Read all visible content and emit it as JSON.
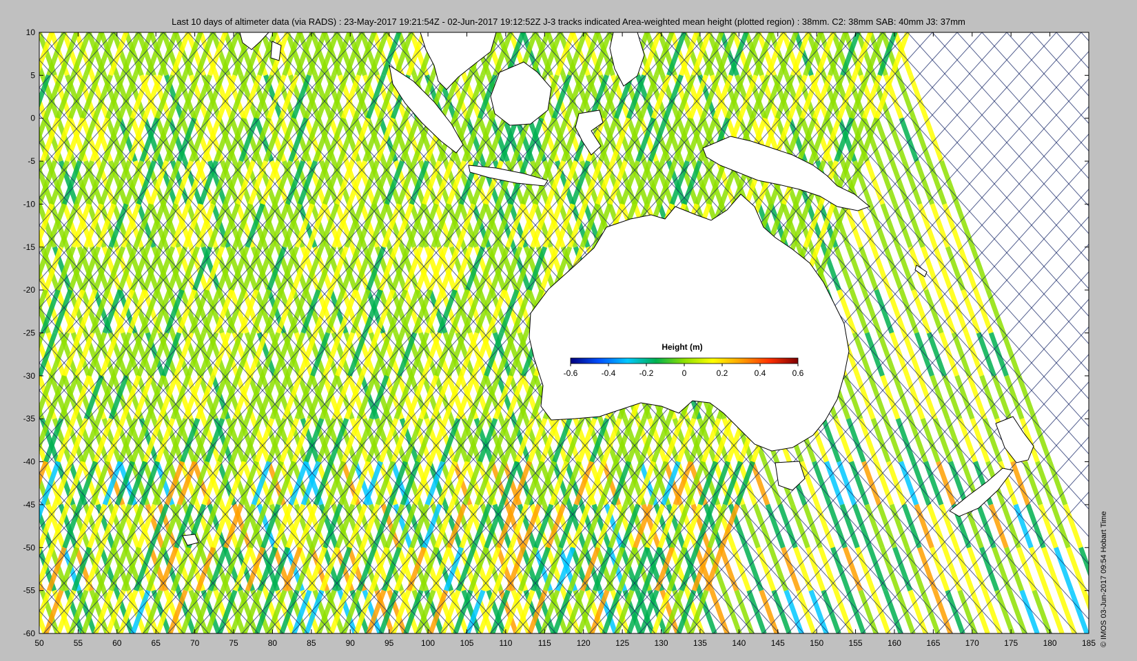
{
  "title": "Last 10 days of altimeter data (via RADS) : 23-May-2017 19:21:54Z - 02-Jun-2017 19:12:52Z  J-3 tracks indicated  Area-weighted mean height (plotted region) : 38mm.  C2: 38mm  SAB: 40mm  J3: 37mm",
  "credit": "© IMOS 03-Jun-2017 09:54 Hobart Time",
  "map": {
    "lon_range": [
      50,
      185
    ],
    "lat_range": [
      -60,
      10
    ],
    "x_ticks": [
      "50",
      "55",
      "60",
      "65",
      "70",
      "75",
      "80",
      "85",
      "90",
      "95",
      "100",
      "105",
      "110",
      "115",
      "120",
      "125",
      "130",
      "135",
      "140",
      "145",
      "150",
      "155",
      "160",
      "165",
      "170",
      "175",
      "180",
      "185"
    ],
    "y_ticks": [
      "10",
      "5",
      "0",
      "-5",
      "-10",
      "-15",
      "-20",
      "-25",
      "-30",
      "-35",
      "-40",
      "-45",
      "-50",
      "-55",
      "-60"
    ],
    "land_color": "#ffffff",
    "track_color": "#1a2a6a"
  },
  "colorbar": {
    "title": "Height (m)",
    "ticks": [
      "-0.6",
      "-0.4",
      "-0.2",
      "0",
      "0.2",
      "0.4",
      "0.6"
    ],
    "colors": [
      "#00007f",
      "#0050ff",
      "#00c8ff",
      "#00b050",
      "#8ee000",
      "#ffff00",
      "#ffa000",
      "#ff3000",
      "#7f0000"
    ]
  }
}
